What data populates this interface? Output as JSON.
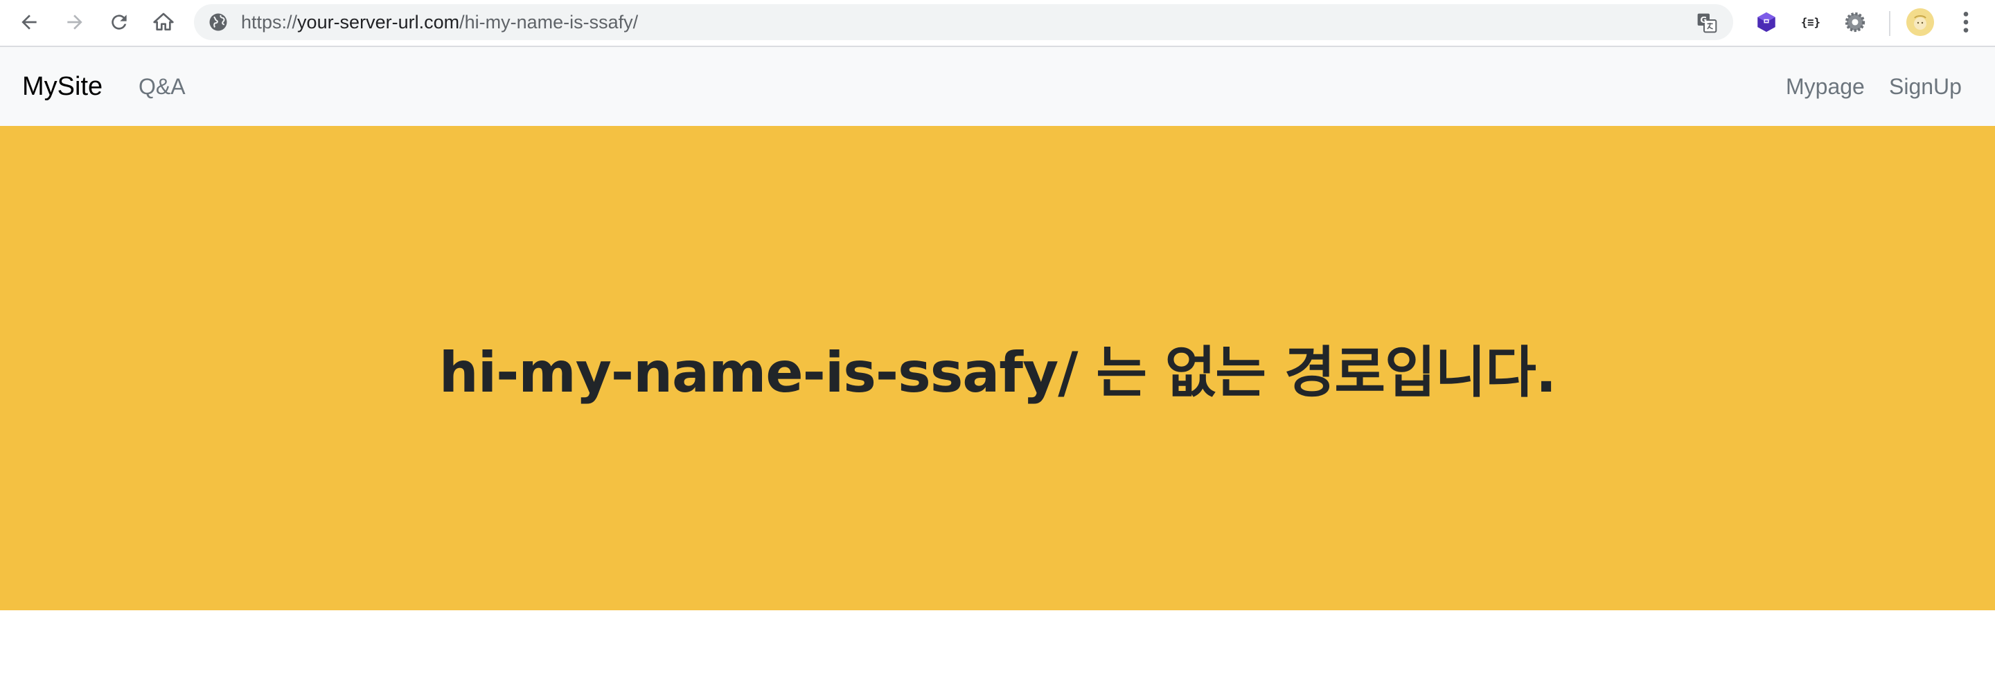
{
  "browser": {
    "url_scheme": "https://",
    "url_host": "your-server-url.com",
    "url_path": "/hi-my-name-is-ssafy/",
    "icons": {
      "back": "back-arrow-icon",
      "forward": "forward-arrow-icon",
      "reload": "reload-icon",
      "home": "home-icon",
      "site_info": "globe-icon",
      "translate": "translate-icon",
      "extensions": [
        "cube-extension-icon",
        "json-extension-icon",
        "gear-extension-icon"
      ],
      "menu": "kebab-menu-icon"
    }
  },
  "navbar": {
    "brand": "MySite",
    "left_links": [
      "Q&A"
    ],
    "right_links": [
      "Mypage",
      "SignUp"
    ]
  },
  "hero": {
    "message": "hi-my-name-is-ssafy/ 는 없는 경로입니다."
  },
  "colors": {
    "hero_background": "#f4c142",
    "navbar_background": "#f8f9fa",
    "text_dark": "#212529",
    "link_muted": "#6c757d"
  }
}
